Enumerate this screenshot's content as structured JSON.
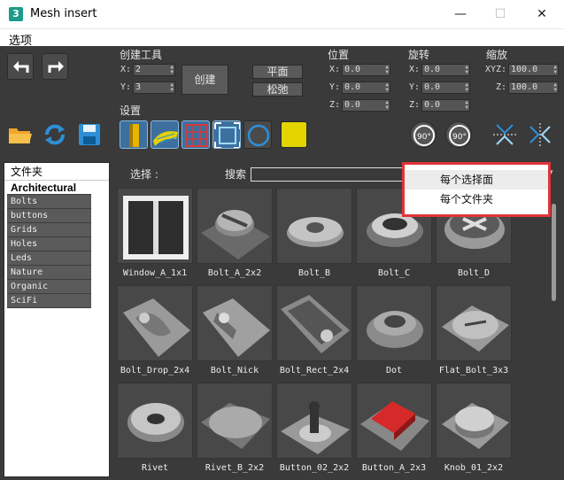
{
  "window": {
    "title": "Mesh insert",
    "app_icon": "3",
    "min": "—",
    "max": "☐",
    "close": "✕"
  },
  "menu": {
    "options": "选项"
  },
  "create_tools": {
    "title": "创建工具",
    "x_label": "X:",
    "x_value": "2",
    "y_label": "Y:",
    "y_value": "3",
    "create_label": "创建",
    "plane_label": "平面",
    "relax_label": "松弛"
  },
  "settings": {
    "title": "设置"
  },
  "position": {
    "title": "位置",
    "x_label": "X:",
    "x": "0.0",
    "y_label": "Y:",
    "y": "0.0",
    "z_label": "Z:",
    "z": "0.0"
  },
  "rotation": {
    "title": "旋转",
    "x_label": "X:",
    "x": "0.0",
    "y_label": "Y:",
    "y": "0.0",
    "z_label": "Z:",
    "z": "0.0",
    "rot_ccw": "90°",
    "rot_cw": "90°"
  },
  "scale": {
    "title": "缩放",
    "xyz_label": "XYZ:",
    "xyz": "100.0",
    "z_label": "Z:",
    "z": "100.0"
  },
  "folders": {
    "header": "文件夹",
    "items": [
      "Architectural",
      "Bolts",
      "buttons",
      "Grids",
      "Holes",
      "Leds",
      "Nature",
      "Organic",
      "SciFi"
    ],
    "selected": "Architectural"
  },
  "toolbar": {
    "select_label": "选择 :",
    "search_label": "搜索"
  },
  "popup": {
    "items": [
      "每个选择面",
      "每个文件夹"
    ],
    "highlighted": "每个选择面"
  },
  "assets": [
    "Window_A_1x1",
    "Bolt_A_2x2",
    "Bolt_B",
    "Bolt_C",
    "Bolt_D",
    "Bolt_Drop_2x4",
    "Bolt_Nick",
    "Bolt_Rect_2x4",
    "Dot",
    "Flat_Bolt_3x3",
    "Rivet",
    "Rivet_B_2x2",
    "Button_02_2x2",
    "Button_A_2x3",
    "Knob_01_2x2"
  ],
  "colors": {
    "accent": "#e0343a",
    "panel": "#444444",
    "button_red": "#d42a2a",
    "yellow_swatch": "#e3d400",
    "icon_blue": "#2d8fd6"
  }
}
